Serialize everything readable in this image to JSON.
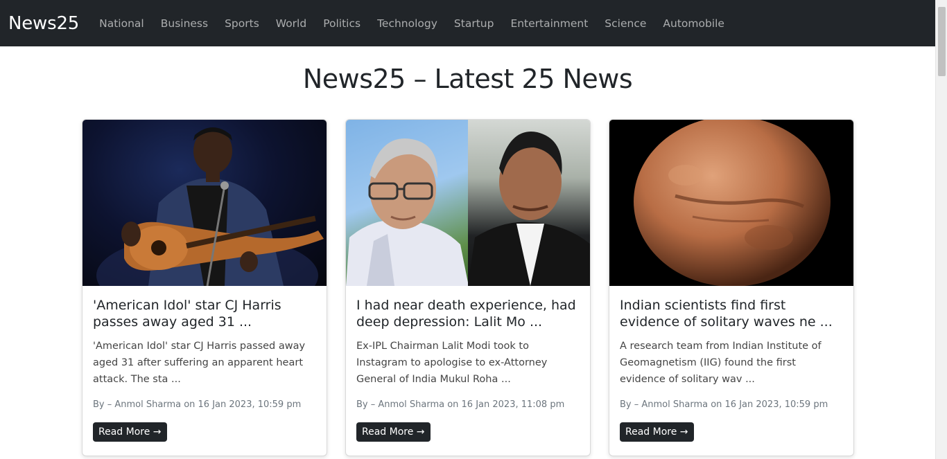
{
  "nav": {
    "brand": "News25",
    "items": [
      "National",
      "Business",
      "Sports",
      "World",
      "Politics",
      "Technology",
      "Startup",
      "Entertainment",
      "Science",
      "Automobile"
    ]
  },
  "page": {
    "title": "News25 – Latest 25 News"
  },
  "cards": [
    {
      "title": "'American Idol' star CJ Harris passes away aged 31 ...",
      "description": "'American Idol' star CJ Harris passed away aged 31 after suffering an apparent heart attack. The sta ...",
      "meta": "By – Anmol Sharma on 16 Jan 2023, 10:59 pm",
      "button": "Read More →"
    },
    {
      "title": "I had near death experience, had deep depression: Lalit Mo ...",
      "description": "Ex-IPL Chairman Lalit Modi took to Instagram to apologise to ex-Attorney General of India Mukul Roha ...",
      "meta": "By – Anmol Sharma on 16 Jan 2023, 11:08 pm",
      "button": "Read More →"
    },
    {
      "title": "Indian scientists find first evidence of solitary waves ne ...",
      "description": "A research team from Indian Institute of Geomagnetism (IIG) found the first evidence of solitary wav ...",
      "meta": "By – Anmol Sharma on 16 Jan 2023, 10:59 pm",
      "button": "Read More →"
    }
  ]
}
